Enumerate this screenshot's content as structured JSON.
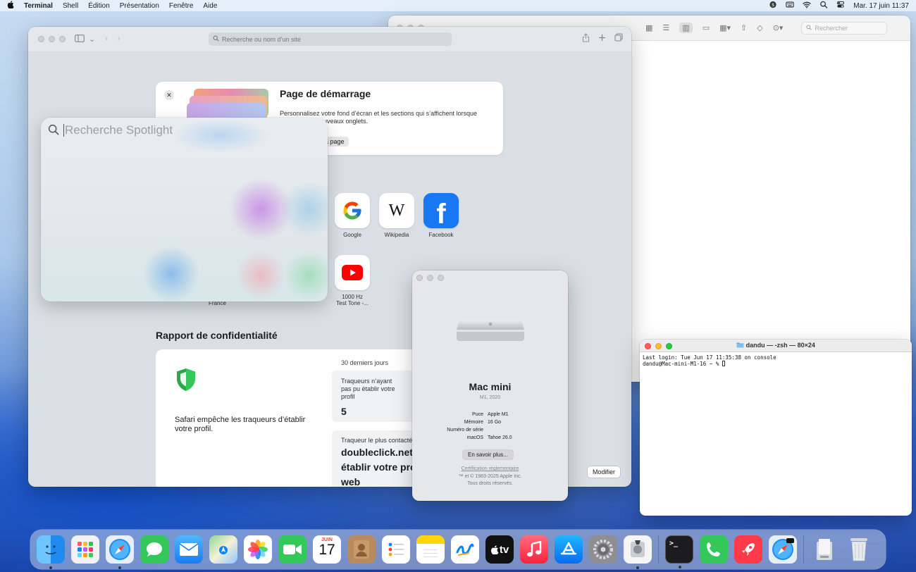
{
  "menubar": {
    "apple": "",
    "app": "Terminal",
    "items": [
      "Shell",
      "Édition",
      "Présentation",
      "Fenêtre",
      "Aide"
    ],
    "datetime": "Mar. 17 juin  11:37"
  },
  "finder": {
    "search_placeholder": "Rechercher"
  },
  "safari": {
    "address_placeholder": "Recherche ou nom d’un site",
    "start_card": {
      "title": "Page de démarrage",
      "description": "Personnalisez votre fond d’écran et les sections qui s’affichent lorsque",
      "description2": "uveaux onglets.",
      "button": "a page"
    },
    "favorites": [
      {
        "label": "Google"
      },
      {
        "label": "Wikipedia"
      },
      {
        "label": "Facebook"
      },
      {
        "label": "1000 Hz",
        "label2": "Test Tone -..."
      }
    ],
    "france_label": "France",
    "privacy": {
      "title": "Rapport de confidentialité",
      "text": "Safari empêche les traqueurs d’établir votre profil.",
      "period": "30 derniers jours",
      "box1_label": "Traqueurs n’ayant pas pu établir votre profil",
      "box1_value": "5",
      "box2_label": "Traqueur le plus contacté",
      "box2_line1": "doubleclick.net",
      "box2_line2": "établir votre pro",
      "box2_line3": "web"
    },
    "modify_button": "Modifier"
  },
  "spotlight": {
    "placeholder": "Recherche Spotlight"
  },
  "about": {
    "name": "Mac mini",
    "year": "M1, 2020",
    "specs": [
      {
        "k": "Puce",
        "v": "Apple M1"
      },
      {
        "k": "Mémoire",
        "v": "16 Go"
      },
      {
        "k": "Numéro de série",
        "v": ""
      },
      {
        "k": "macOS",
        "v": "Tahoe 26.0"
      }
    ],
    "more_button": "En savoir plus...",
    "certification": "Certification réglementaire",
    "copyright1": "™ et © 1983-2025 Apple Inc.",
    "copyright2": "Tous droits réservés."
  },
  "terminal": {
    "title": "dandu — -zsh — 80×24",
    "line1": "Last login: Tue Jun 17 11:35:38 on console",
    "line2": "dandu@Mac-mini-M1-16 ~ % "
  },
  "dock": {
    "calendar_month": "JUIN",
    "calendar_day": "17",
    "tv_label": "tv",
    "items": [
      "finder-icon",
      "launchpad-icon",
      "safari-icon",
      "messages-icon",
      "mail-icon",
      "maps-icon",
      "photos-icon",
      "facetime-icon",
      "calendar-icon",
      "contacts-icon",
      "reminders-icon",
      "notes-icon",
      "freeform-icon",
      "apple-tv-icon",
      "music-icon",
      "app-store-icon",
      "system-settings-icon",
      "disk-utility-icon",
      "terminal-icon",
      "phone-icon",
      "rocket-icon",
      "safari-beta-icon",
      "downloads-icon",
      "trash-icon"
    ]
  },
  "colors": {
    "accent": "#0a84ff",
    "shield_green": "#34c759",
    "facebook_blue": "#1877f2",
    "youtube_red": "#ff0000"
  }
}
